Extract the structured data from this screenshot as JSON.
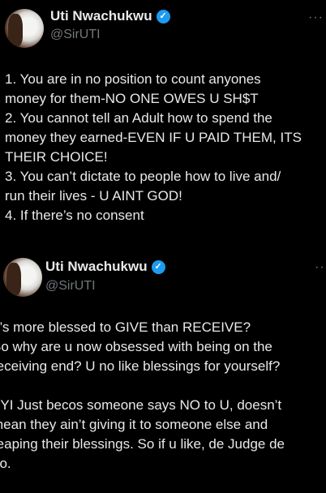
{
  "tweets": [
    {
      "author_name": "Uti Nwachukwu",
      "handle": "@SirUTI",
      "verified_mark": "✓",
      "more_label": "···",
      "text": "1. You are in no position to count anyones\nmoney for them-NO ONE OWES U SH$T\n2. You cannot tell an Adult how to spend the\nmoney they earned-EVEN IF U PAID THEM, ITS\nTHEIR CHOICE!\n3. You can’t dictate to people how to live and/\nrun their lives - U AINT GOD!\n4. If there’s no consent"
    },
    {
      "author_name": "Uti Nwachukwu",
      "handle": "@SirUTI",
      "verified_mark": "✓",
      "more_label": "···",
      "text": "It’s more blessed to GIVE than RECEIVE?\nSo why are u now obsessed with being on the\nreceiving end? U no like blessings for yourself?\n\nFYI Just becos someone says NO to U, doesn’t\nmean they ain’t giving it to someone else and\nreaping their blessings. So if u like, de Judge de\ngo."
    }
  ],
  "colors": {
    "background": "#000000",
    "text": "#e7e9ea",
    "secondary": "#71767b",
    "verified": "#1d9bf0"
  }
}
